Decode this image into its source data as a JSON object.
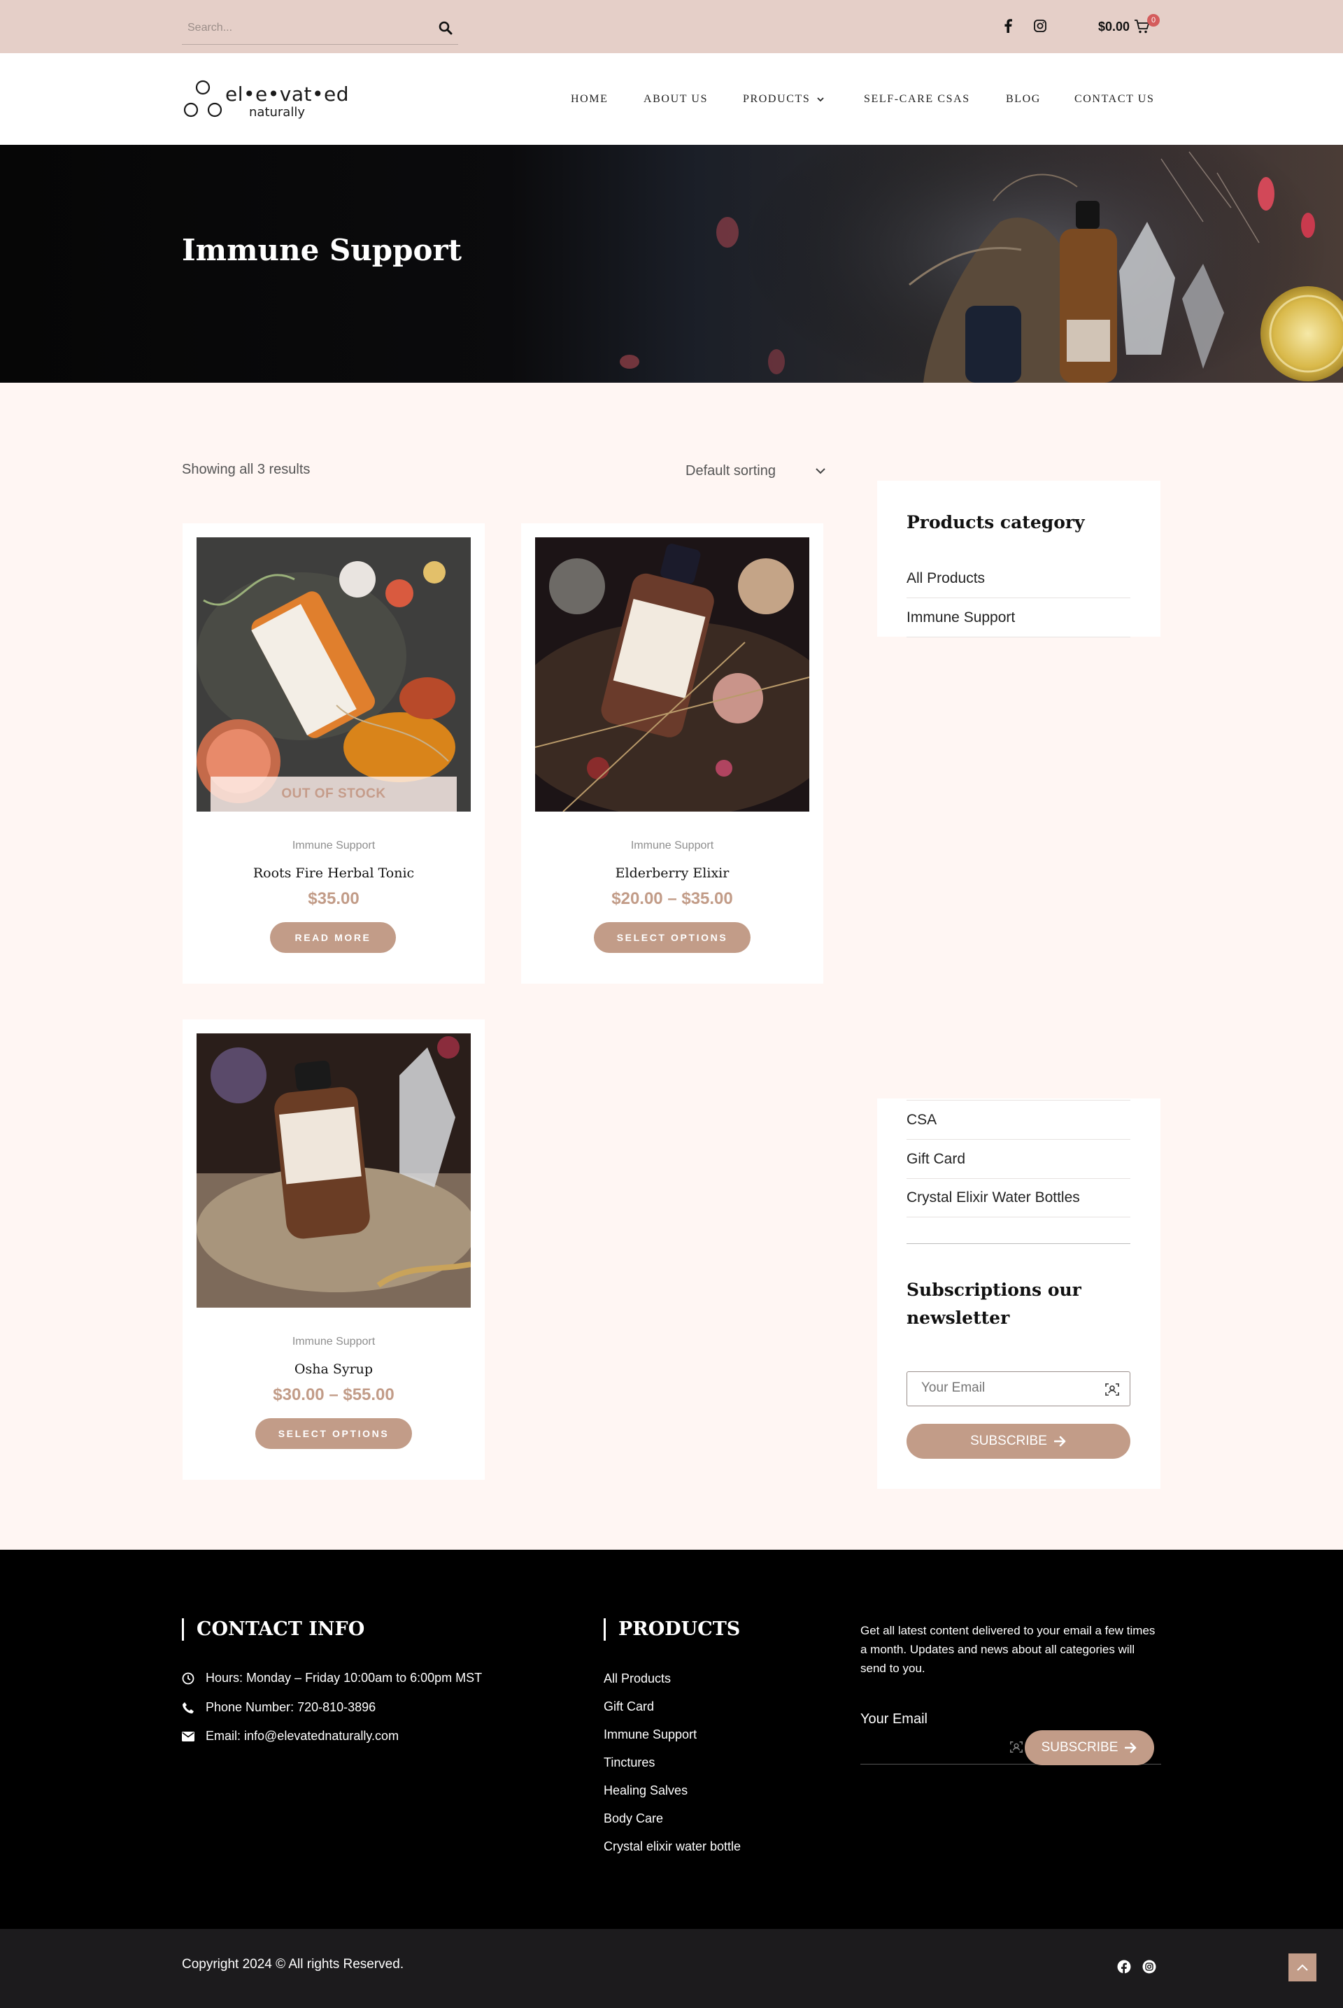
{
  "topbar": {
    "search_placeholder": "Search...",
    "cart_total": "$0.00",
    "cart_count": "0",
    "social": [
      "facebook-icon",
      "instagram-icon"
    ]
  },
  "header": {
    "logo_text": "el•e•vat•ed",
    "logo_sub": "naturally",
    "nav": [
      {
        "label": "HOME"
      },
      {
        "label": "ABOUT US"
      },
      {
        "label": "PRODUCTS"
      },
      {
        "label": "SELF-CARE CSAS"
      },
      {
        "label": "BLOG"
      },
      {
        "label": "CONTACT US"
      }
    ]
  },
  "hero": {
    "title": "Immune Support"
  },
  "shop": {
    "result_count": "Showing all 3 results",
    "sort_selected": "Default sorting",
    "products": [
      {
        "category": "Immune Support",
        "name": "Roots Fire Herbal Tonic",
        "price": "$35.00",
        "button": "READ MORE",
        "badge": "OUT OF STOCK"
      },
      {
        "category": "Immune Support",
        "name": "Elderberry Elixir",
        "price": "$20.00 – $35.00",
        "button": "SELECT OPTIONS"
      },
      {
        "category": "Immune Support",
        "name": "Osha Syrup",
        "price": "$30.00 – $55.00",
        "button": "SELECT OPTIONS"
      }
    ]
  },
  "sidebar": {
    "category_title": "Products category",
    "categories_top": [
      "All Products",
      "Immune Support"
    ],
    "categories_bottom": [
      "CSA",
      "Gift Card",
      "Crystal Elixir Water Bottles"
    ],
    "newsletter_title": "Subscriptions our newsletter",
    "email_placeholder": "Your Email",
    "subscribe": "SUBSCRIBE"
  },
  "footer": {
    "contact_heading": "CONTACT INFO",
    "hours": "Hours: Monday – Friday 10:00am to 6:00pm MST",
    "phone": "Phone Number: 720-810-3896",
    "email": "Email: info@elevatednaturally.com",
    "products_heading": "PRODUCTS",
    "product_links": [
      "All Products",
      "Gift Card",
      "Immune Support",
      "Tinctures",
      "Healing Salves",
      "Body Care",
      "Crystal elixir water bottle"
    ],
    "newsletter_text": "Get all latest content delivered to your email a few times a month. Updates and news about all categories will send to you.",
    "email_label": "Your Email",
    "subscribe": "SUBSCRIBE"
  },
  "bottom": {
    "copyright": "Copyright 2024 © All rights Reserved."
  },
  "colors": {
    "accent": "#c29c88",
    "topbar_bg": "#e5cfc8",
    "page_bg": "#fff6f3",
    "footer_bg": "#000000",
    "badge": "#d45c5c"
  }
}
